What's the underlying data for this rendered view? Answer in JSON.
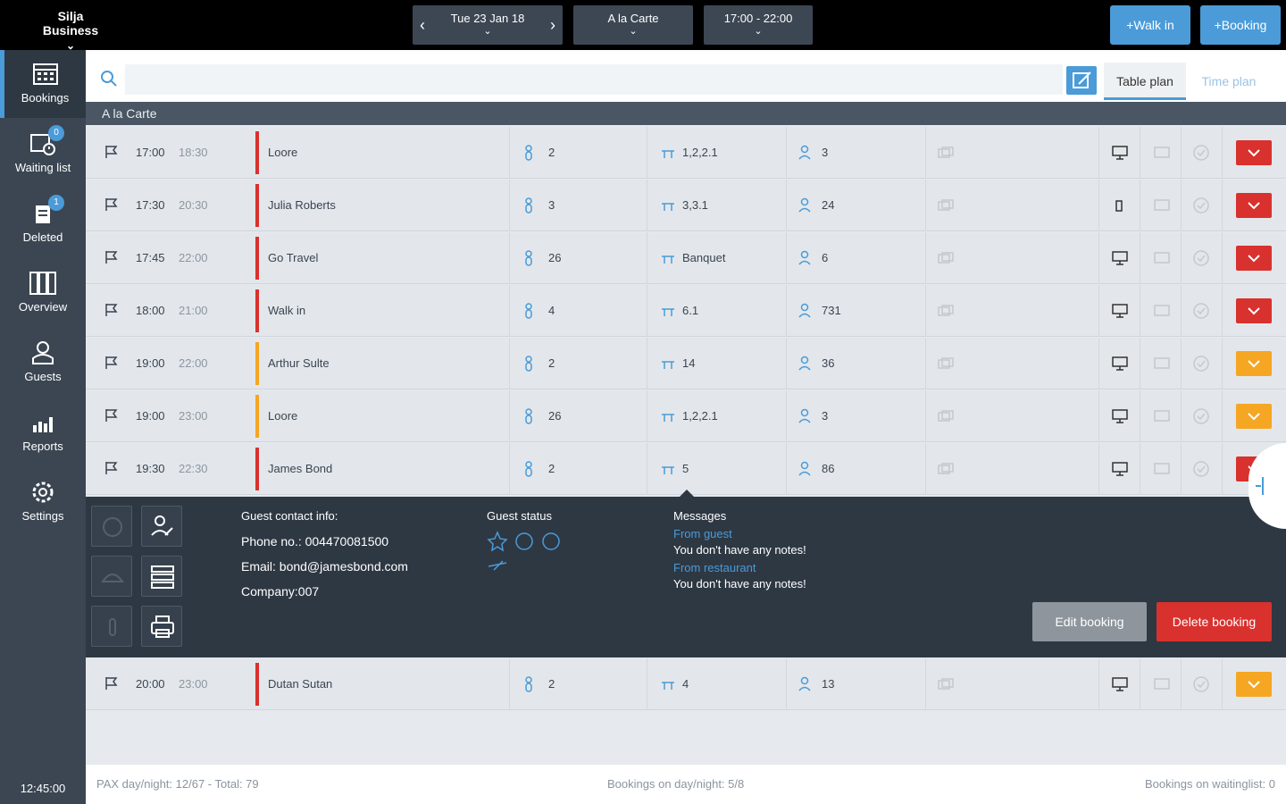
{
  "header": {
    "brand": "Silja Business",
    "date": "Tue 23 Jan 18",
    "restaurant": "A la Carte",
    "time_range": "17:00 - 22:00",
    "walkin_label": "+Walk in",
    "booking_label": "+Booking"
  },
  "sidebar": {
    "items": [
      {
        "label": "Bookings"
      },
      {
        "label": "Waiting list",
        "badge": "0"
      },
      {
        "label": "Deleted",
        "badge": "1"
      },
      {
        "label": "Overview"
      },
      {
        "label": "Guests"
      },
      {
        "label": "Reports"
      },
      {
        "label": "Settings"
      }
    ],
    "clock": "12:45:00"
  },
  "search": {
    "placeholder": ""
  },
  "tabs": [
    {
      "label": "Table plan"
    },
    {
      "label": "Time plan"
    }
  ],
  "section_title": "A la Carte",
  "rows": [
    {
      "start": "17:00",
      "end": "18:30",
      "name": "Loore",
      "pax": "2",
      "table": "1,2,2.1",
      "guests": "3",
      "device": "monitor",
      "bar": "#d9312e",
      "action": "#d9312e"
    },
    {
      "start": "17:30",
      "end": "20:30",
      "name": "Julia Roberts",
      "pax": "3",
      "table": "3,3.1",
      "guests": "24",
      "device": "phone",
      "bar": "#d9312e",
      "action": "#d9312e"
    },
    {
      "start": "17:45",
      "end": "22:00",
      "name": "Go Travel",
      "pax": "26",
      "table": "Banquet",
      "guests": "6",
      "device": "monitor",
      "bar": "#d9312e",
      "action": "#d9312e"
    },
    {
      "start": "18:00",
      "end": "21:00",
      "name": "Walk in",
      "pax": "4",
      "table": "6.1",
      "guests": "731",
      "device": "monitor",
      "bar": "#d9312e",
      "action": "#d9312e"
    },
    {
      "start": "19:00",
      "end": "22:00",
      "name": "Arthur Sulte",
      "pax": "2",
      "table": "14",
      "guests": "36",
      "device": "monitor",
      "bar": "#f5a623",
      "action": "#f5a623"
    },
    {
      "start": "19:00",
      "end": "23:00",
      "name": "Loore",
      "pax": "26",
      "table": "1,2,2.1",
      "guests": "3",
      "device": "monitor",
      "bar": "#f5a623",
      "action": "#f5a623"
    },
    {
      "start": "19:30",
      "end": "22:30",
      "name": "James Bond",
      "pax": "2",
      "table": "5",
      "guests": "86",
      "device": "monitor",
      "bar": "#d9312e",
      "action": "#d9312e"
    }
  ],
  "last_row": {
    "start": "20:00",
    "end": "23:00",
    "name": "Dutan Sutan",
    "pax": "2",
    "table": "4",
    "guests": "13",
    "device": "monitor",
    "bar": "#d9312e",
    "action": "#f5a623"
  },
  "detail": {
    "contact_title": "Guest contact info:",
    "phone": "Phone no.: 004470081500",
    "email": "Email: bond@jamesbond.com",
    "company": "Company:007",
    "status_title": "Guest status",
    "messages_title": "Messages",
    "from_guest": "From guest",
    "guest_note": "You don't have any notes!",
    "from_restaurant": "From restaurant",
    "restaurant_note": "You don't have any notes!",
    "edit_label": "Edit booking",
    "delete_label": "Delete booking"
  },
  "footer": {
    "pax": "PAX day/night: 12/67 - Total: 79",
    "bookings": "Bookings on day/night: 5/8",
    "waiting": "Bookings on waitinglist: 0"
  },
  "colors": {
    "accent": "#4a9bd8",
    "danger": "#d9312e",
    "warning": "#f5a623"
  }
}
